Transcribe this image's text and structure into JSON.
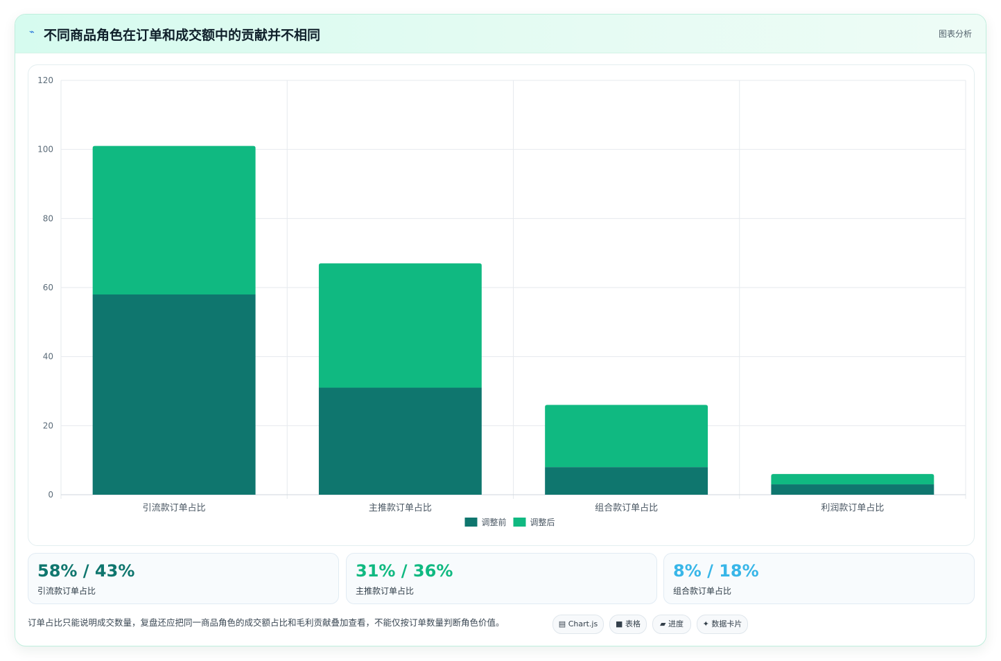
{
  "header": {
    "icon": "chart-line-icon",
    "title": "不同商品角色在订单和成交额中的贡献并不相同",
    "tag": "图表分析"
  },
  "chart_data": {
    "type": "bar",
    "stacked": true,
    "categories": [
      "引流款订单占比",
      "主推款订单占比",
      "组合款订单占比",
      "利润款订单占比"
    ],
    "series": [
      {
        "name": "调整前",
        "values": [
          58,
          31,
          8,
          3
        ],
        "color": "#0f766e"
      },
      {
        "name": "调整后",
        "values": [
          43,
          36,
          18,
          3
        ],
        "color": "#10b981"
      }
    ],
    "ylim": [
      0,
      120
    ],
    "yticks": [
      0,
      20,
      40,
      60,
      80,
      100,
      120
    ],
    "grid": true,
    "legend": "bottom-center"
  },
  "stats": [
    {
      "value": "58% / 43%",
      "label": "引流款订单占比",
      "color": "#0f766e"
    },
    {
      "value": "31% / 36%",
      "label": "主推款订单占比",
      "color": "#10b981"
    },
    {
      "value": "8% / 18%",
      "label": "组合款订单占比",
      "color": "#38b6e8"
    }
  ],
  "footer": {
    "note": "订单占比只能说明成交数量，复盘还应把同一商品角色的成交额占比和毛利贡献叠加查看，不能仅按订单数量判断角色价值。",
    "pills": [
      {
        "icon": "chart-icon",
        "glyph": "▤",
        "label": "Chart.js"
      },
      {
        "icon": "table-icon",
        "glyph": "■",
        "label": "表格"
      },
      {
        "icon": "progress-icon",
        "glyph": "▰",
        "label": "进度"
      },
      {
        "icon": "sparkle-icon",
        "glyph": "✦",
        "label": "数据卡片"
      }
    ]
  }
}
